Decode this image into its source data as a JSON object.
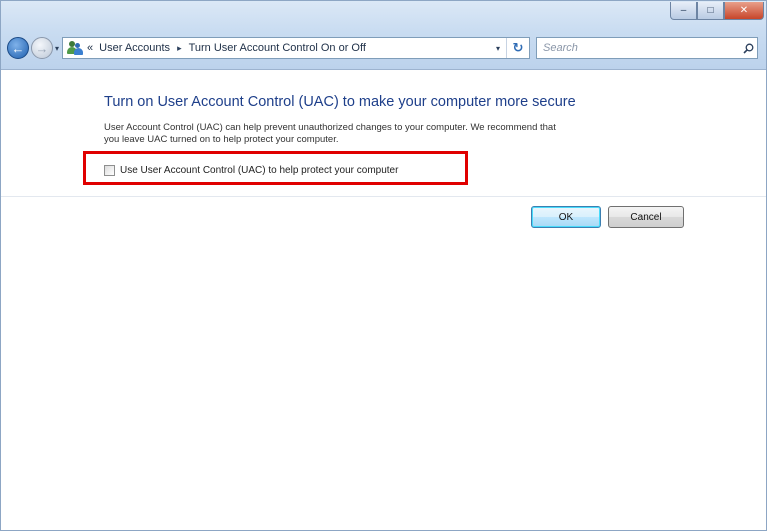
{
  "window": {
    "controls": {
      "minimize": "–",
      "maximize": "□",
      "close": "✕"
    }
  },
  "nav": {
    "back_icon": "←",
    "forward_icon": "→",
    "recent_icon": "▾",
    "address": {
      "icon": "user-accounts-icon",
      "overflow": "«",
      "crumbs": [
        "User Accounts",
        "Turn User Account Control On or Off"
      ],
      "separator": "▸",
      "dropdown": "▾",
      "refresh": "↻"
    },
    "search": {
      "placeholder": "Search"
    }
  },
  "main": {
    "heading": "Turn on User Account Control (UAC) to make your computer more secure",
    "description_line1": "User Account Control (UAC) can help prevent unauthorized changes to your computer.  We recommend that",
    "description_line2": "you leave UAC turned on to help protect your computer.",
    "checkbox_label": "Use User Account Control (UAC) to help protect your computer",
    "checkbox_checked": false,
    "highlight_color": "#e00000"
  },
  "buttons": {
    "ok": "OK",
    "cancel": "Cancel"
  }
}
